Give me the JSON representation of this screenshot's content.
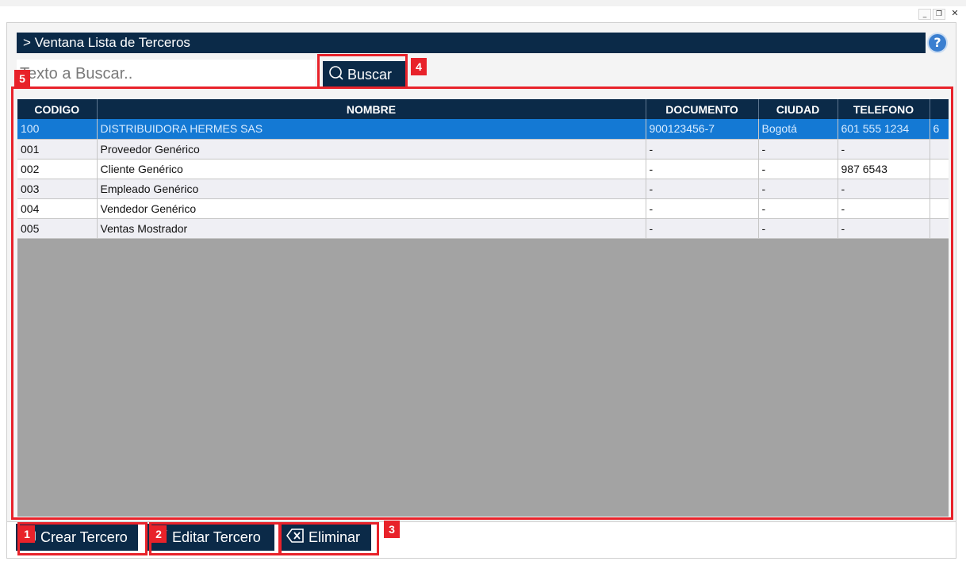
{
  "window": {
    "title": "> Ventana Lista de Terceros"
  },
  "search": {
    "placeholder": "Texto a Buscar..",
    "button_label": "Buscar"
  },
  "table": {
    "columns": [
      "CODIGO",
      "NOMBRE",
      "DOCUMENTO",
      "CIUDAD",
      "TELEFONO"
    ],
    "rows": [
      {
        "codigo": "100",
        "nombre": "DISTRIBUIDORA HERMES SAS",
        "documento": "900123456-7",
        "ciudad": "Bogotá",
        "telefono": "601 555 1234",
        "extra": "6"
      },
      {
        "codigo": "001",
        "nombre": "Proveedor Genérico",
        "documento": "-",
        "ciudad": "-",
        "telefono": "-",
        "extra": ""
      },
      {
        "codigo": "002",
        "nombre": "Cliente Genérico",
        "documento": "-",
        "ciudad": "-",
        "telefono": "987 6543",
        "extra": ""
      },
      {
        "codigo": "003",
        "nombre": "Empleado Genérico",
        "documento": "-",
        "ciudad": "-",
        "telefono": "-",
        "extra": ""
      },
      {
        "codigo": "004",
        "nombre": "Vendedor Genérico",
        "documento": "-",
        "ciudad": "-",
        "telefono": "-",
        "extra": ""
      },
      {
        "codigo": "005",
        "nombre": "Ventas Mostrador",
        "documento": "-",
        "ciudad": "-",
        "telefono": "-",
        "extra": ""
      }
    ]
  },
  "actions": {
    "crear": "Crear Tercero",
    "editar": "Editar Tercero",
    "eliminar": "Eliminar"
  },
  "badges": [
    "1",
    "2",
    "3",
    "4",
    "5"
  ],
  "colors": {
    "navy": "#0b2a48",
    "selected_row": "#1479d4",
    "highlight": "#e8222a",
    "grid_bg": "#a3a3a3"
  }
}
